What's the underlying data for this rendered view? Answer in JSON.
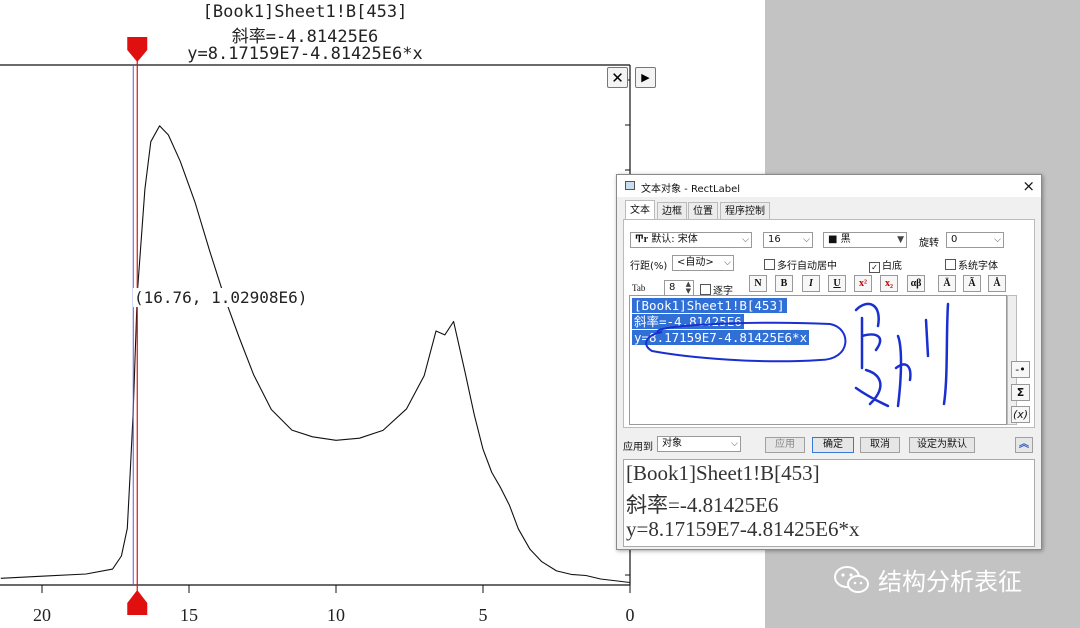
{
  "plot": {
    "header_line1": "[Book1]Sheet1!B[453]",
    "header_line2": "斜率=-4.81425E6",
    "header_line3": "y=8.17159E7-4.81425E6*x",
    "coord_label": "(16.76, 1.02908E6)",
    "x_ticks": [
      "20",
      "15",
      "10",
      "5",
      "0"
    ],
    "close_icon": "close-x-icon",
    "arrow_icon": "play-arrow-icon",
    "marker_color": "#e01010",
    "curve_color": "#111111"
  },
  "chart_data": {
    "type": "line",
    "title": "",
    "xlabel": "",
    "ylabel": "",
    "xlim": [
      21.4,
      0
    ],
    "reverse_x": true,
    "x_ticks": [
      20,
      15,
      10,
      5,
      0
    ],
    "series": [
      {
        "x": [
          21.4,
          20,
          18.5,
          17.6,
          17.3,
          17.1,
          17.0,
          16.9,
          16.76,
          16.5,
          16.3,
          16.0,
          15.7,
          15.3,
          14.8,
          14.3,
          13.8,
          13.3,
          12.8,
          12.2,
          11.5,
          10.8,
          10.0,
          9.2,
          8.4,
          7.6,
          7.0,
          6.6,
          6.3,
          6.0,
          5.8,
          5.6,
          5.3,
          5.0,
          4.7,
          4.4,
          4.1,
          3.8,
          3.4,
          3.0,
          2.5,
          2.0,
          1.5,
          1.0,
          0
        ],
        "y": [
          0.02,
          0.03,
          0.04,
          0.06,
          0.1,
          0.2,
          0.4,
          0.6,
          1.02908,
          1.4,
          1.57,
          1.62,
          1.59,
          1.5,
          1.35,
          1.18,
          1.02,
          0.88,
          0.74,
          0.62,
          0.55,
          0.52,
          0.51,
          0.52,
          0.55,
          0.62,
          0.74,
          0.9,
          0.88,
          0.93,
          0.84,
          0.75,
          0.6,
          0.48,
          0.4,
          0.34,
          0.28,
          0.2,
          0.13,
          0.08,
          0.05,
          0.04,
          0.03,
          0.02,
          0.01
        ]
      }
    ],
    "cursor_x": 16.76,
    "cursor_y": 1.02908,
    "grid": false,
    "legend": "none"
  },
  "dialog": {
    "title": "文本对象 - RectLabel",
    "tabs": [
      "文本",
      "边框",
      "位置",
      "程序控制"
    ],
    "font_label": "默认: 宋体",
    "size_value": "16",
    "color_value": "■ 黑",
    "rotate_label": "旋转",
    "rotate_value": "0",
    "line_spacing_label": "行距(%)",
    "line_spacing_value": "<自动>",
    "multiline_center_label": "多行自动居中",
    "white_bg_label": "白底",
    "system_font_label": "系统字体",
    "tab_label": "Tab",
    "tab_value": "8",
    "char_by_char_label": "逐字",
    "format_buttons": [
      "N",
      "B",
      "I",
      "U",
      "x²",
      "x₂",
      "αβ",
      "Ā",
      "Ã",
      "Å"
    ],
    "editor_lines": [
      "[Book1]Sheet1!B[453]",
      "斜率=-4.81425E6",
      "y=8.17159E7-4.81425E6*x"
    ],
    "handwriting": "复制",
    "apply_to_label": "应用到",
    "apply_to_value": "对象",
    "apply_button": "应用",
    "ok_button": "确定",
    "cancel_button": "取消",
    "set_default_button": "设定为默认",
    "side_buttons": [
      "-•",
      "Σ",
      "(x)"
    ],
    "collapse_icon": "double-chevron-up-icon",
    "preview_lines": [
      "[Book1]Sheet1!B[453]",
      "斜率=-4.81425E6",
      "y=8.17159E7-4.81425E6*x"
    ]
  },
  "watermark": {
    "text": "结构分析表征",
    "icon": "wechat-icon"
  }
}
